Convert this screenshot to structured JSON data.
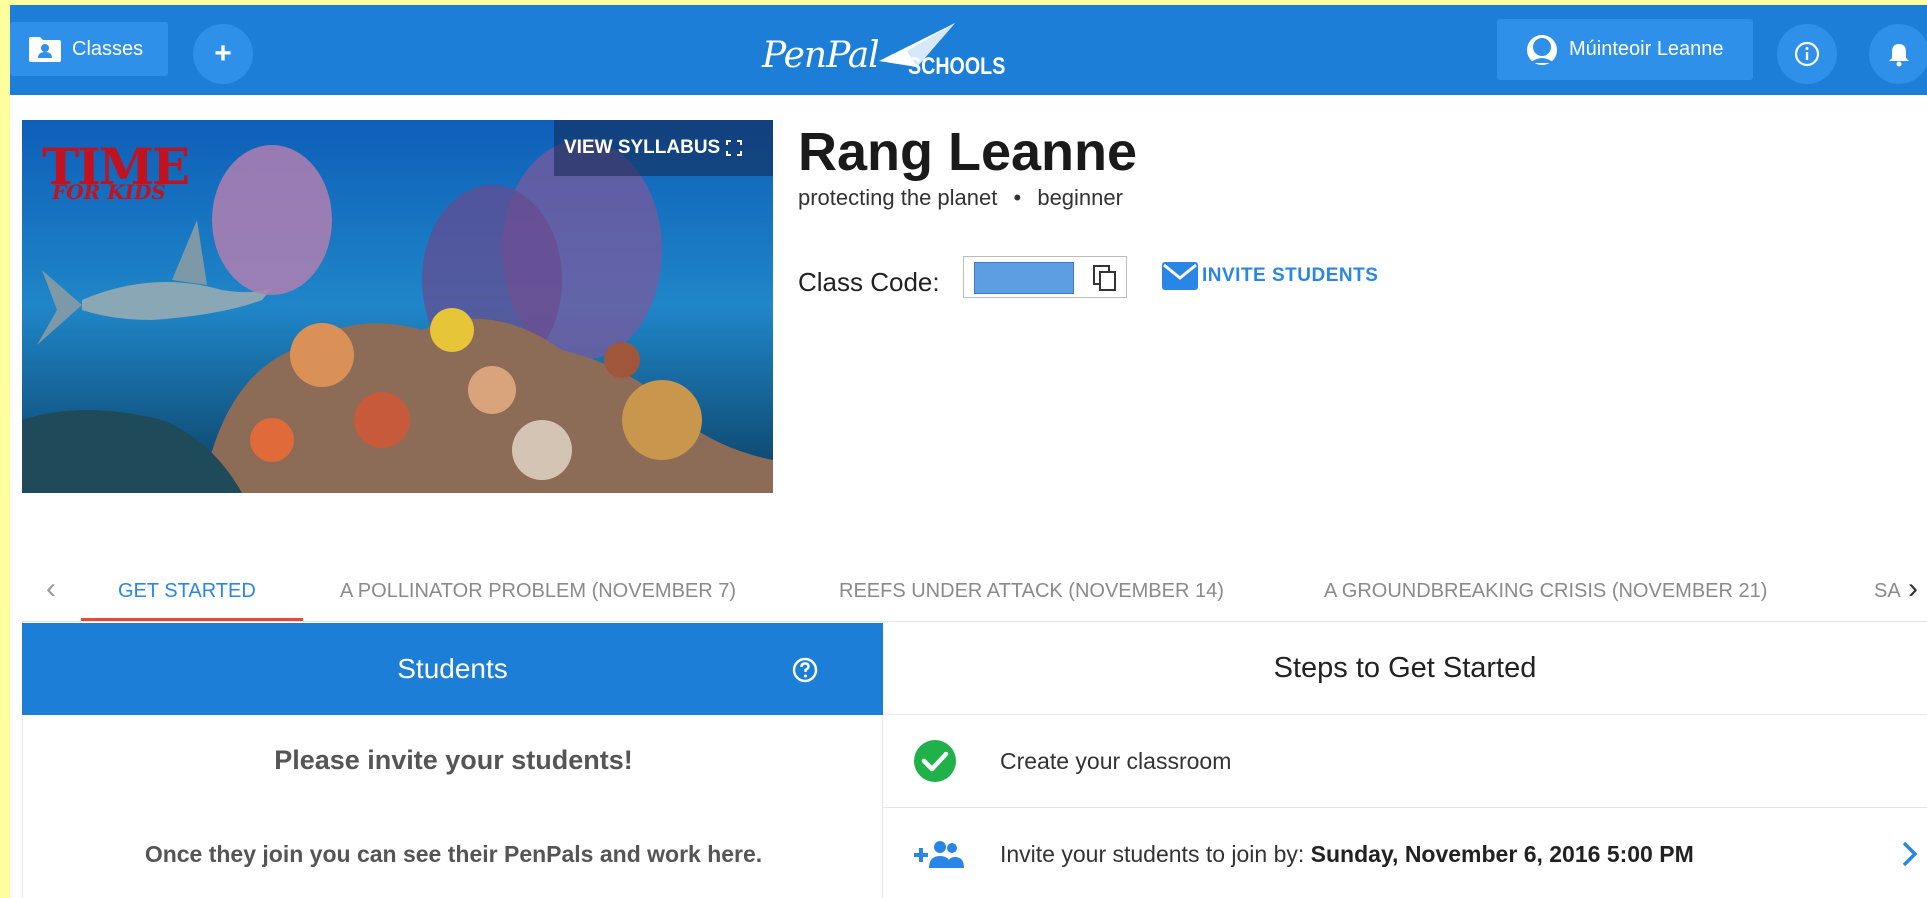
{
  "nav": {
    "classes_label": "Classes",
    "add_label": "+",
    "logo_pen": "PenPal",
    "logo_schools": "SCHOOLS",
    "user_name": "Múinteoir Leanne"
  },
  "hero": {
    "brand_line1": "TIME",
    "brand_line2": "FOR KIDS",
    "syllabus_label": "VIEW SYLLABUS"
  },
  "class_info": {
    "title": "Rang Leanne",
    "topic": "protecting the planet",
    "separator": "•",
    "level": "beginner",
    "code_label": "Class Code:",
    "invite_label": "INVITE STUDENTS"
  },
  "tabs": [
    {
      "label": "GET STARTED"
    },
    {
      "label": "A POLLINATOR PROBLEM (NOVEMBER 7)"
    },
    {
      "label": "REEFS UNDER ATTACK (NOVEMBER 14)"
    },
    {
      "label": "A GROUNDBREAKING CRISIS (NOVEMBER 21)"
    },
    {
      "label": "SA"
    }
  ],
  "students": {
    "header": "Students",
    "invite_heading": "Please invite your students!",
    "invite_sub": "Once they join you can see their PenPals and work here."
  },
  "steps": {
    "header": "Steps to Get Started",
    "items": [
      {
        "text": "Create your classroom",
        "bold": ""
      },
      {
        "text": "Invite your students to join by: ",
        "bold": "Sunday, November 6, 2016 5:00 PM"
      }
    ]
  },
  "colors": {
    "primary": "#1c7ed6",
    "accent_link": "#2a86e6",
    "tab_underline": "#e8493b",
    "check": "#21b14a",
    "page_background": "#fefe9c"
  }
}
